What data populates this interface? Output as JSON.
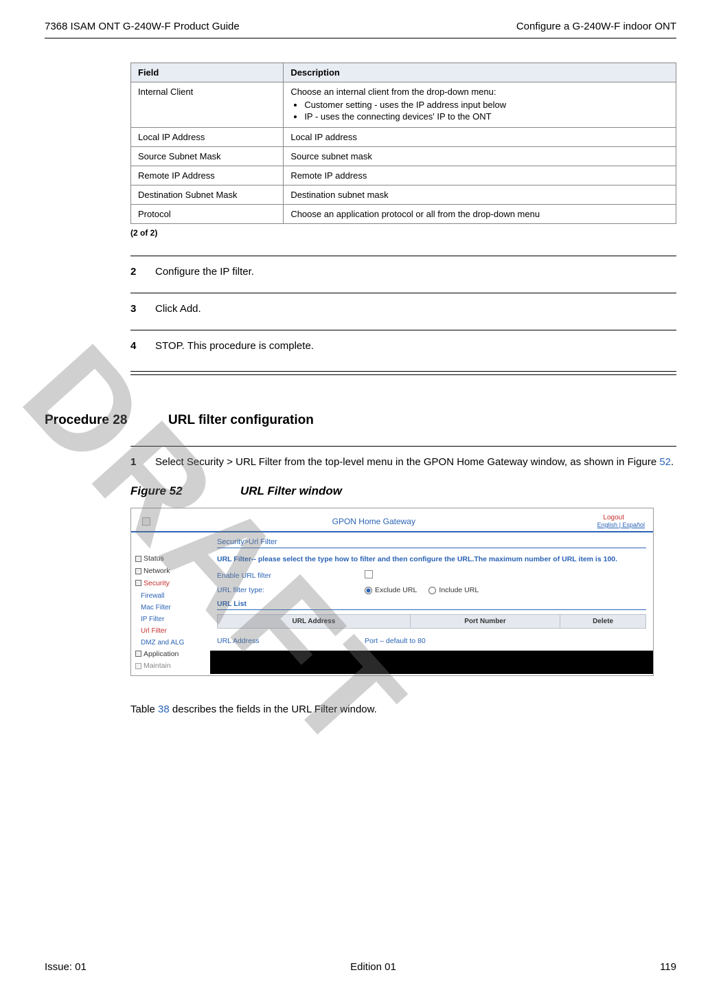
{
  "header": {
    "left": "7368 ISAM ONT G-240W-F Product Guide",
    "right": "Configure a G-240W-F indoor ONT"
  },
  "watermark": "DRAFT",
  "table": {
    "headers": [
      "Field",
      "Description"
    ],
    "rows": [
      {
        "field": "Internal Client",
        "desc_intro": "Choose an internal client from the drop-down menu:",
        "bullets": [
          "Customer setting - uses the IP address input below",
          "IP - uses the connecting devices' IP to the ONT"
        ]
      },
      {
        "field": "Local IP Address",
        "desc": "Local IP address"
      },
      {
        "field": "Source Subnet Mask",
        "desc": "Source subnet mask"
      },
      {
        "field": "Remote IP Address",
        "desc": "Remote IP address"
      },
      {
        "field": "Destination Subnet Mask",
        "desc": "Destination subnet mask"
      },
      {
        "field": "Protocol",
        "desc": "Choose an application protocol or all from the drop-down menu"
      }
    ],
    "footer": "(2 of 2)"
  },
  "steps_a": [
    {
      "num": "2",
      "text": "Configure the IP filter."
    },
    {
      "num": "3",
      "text": "Click Add."
    },
    {
      "num": "4",
      "text": "STOP. This procedure is complete."
    }
  ],
  "procedure": {
    "label": "Procedure 28",
    "title": "URL filter configuration"
  },
  "step_b": {
    "num": "1",
    "text_pre": "Select Security > URL Filter from the top-level menu in the GPON Home Gateway window, as shown in Figure ",
    "ref": "52",
    "text_post": "."
  },
  "figure": {
    "label": "Figure 52",
    "title": "URL Filter window"
  },
  "screenshot": {
    "app_title": "GPON Home Gateway",
    "logout": "Logout",
    "langs": "English | Español",
    "breadcrumb": "Security>Url Filter",
    "subtitle": "URL Filter-- please select the type how to filter and then configure the URL.The maximum number of URL item is 100.",
    "sidebar": {
      "items": [
        {
          "label": "Status",
          "type": "top"
        },
        {
          "label": "Network",
          "type": "top"
        },
        {
          "label": "Security",
          "type": "top",
          "selected": true
        },
        {
          "label": "Firewall",
          "type": "sub"
        },
        {
          "label": "Mac Filter",
          "type": "sub"
        },
        {
          "label": "IP Filter",
          "type": "sub"
        },
        {
          "label": "Url Filter",
          "type": "sub",
          "selected": true
        },
        {
          "label": "DMZ and ALG",
          "type": "sub"
        },
        {
          "label": "Application",
          "type": "top"
        },
        {
          "label": "Maintain",
          "type": "top"
        }
      ]
    },
    "rows": {
      "enable_label": "Enable URL filter",
      "type_label": "URL filter type:",
      "type_opt1": "Exclude URL",
      "type_opt2": "Include URL"
    },
    "list_section": "URL List",
    "list_headers": [
      "URL Address",
      "Port Number",
      "Delete"
    ],
    "bottom_row": {
      "addr_label": "URL Address",
      "port_label": "Port – default to 80"
    }
  },
  "after_figure": {
    "pre": "Table ",
    "ref": "38",
    "post": " describes the fields in the URL Filter window."
  },
  "footer": {
    "left": "Issue: 01",
    "center": "Edition 01",
    "right": "119"
  }
}
